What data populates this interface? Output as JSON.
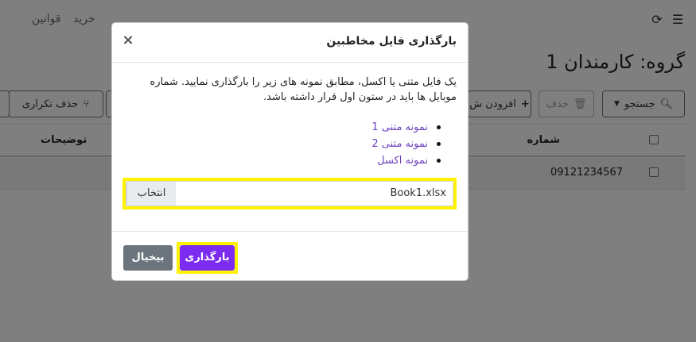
{
  "topbar": {
    "nav_items": [
      "خرید",
      "قوانین"
    ]
  },
  "group_title": "گروه: کارمندان 1",
  "toolbar": {
    "search_label": "جستجو",
    "delete_label": "حذف",
    "add_label": "افزودن ش",
    "remove_dup_label": "حذف تکراری"
  },
  "table": {
    "columns": [
      "شماره",
      "توضیحات"
    ],
    "rows": [
      {
        "number": "09121234567",
        "description": ""
      }
    ]
  },
  "modal": {
    "title": "بارگذاری فایل مخاطبین",
    "close_label": "×",
    "description": "یک فایل متنی یا اکسل، مطابق نمونه های زیر را بارگذاری نمایید. شماره موبایل ها باید در ستون اول قرار داشته باشد.",
    "samples": [
      "نمونه متنی 1",
      "نمونه متنی 2",
      "نمونه اکسل"
    ],
    "file_input": {
      "value": "Book1.xlsx",
      "browse_label": "انتخاب"
    },
    "upload_label": "بارگذاری",
    "cancel_label": "بیخیال"
  },
  "colors": {
    "primary": "#7b2cf0",
    "secondary": "#6c757d",
    "highlight": "#fff200",
    "link": "#6f42c1"
  }
}
